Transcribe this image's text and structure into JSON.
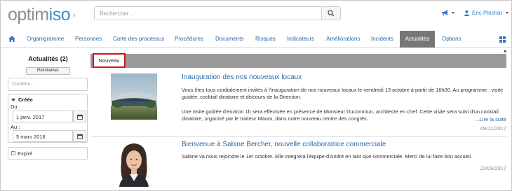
{
  "header": {
    "logo_prefix": "optim",
    "logo_suffix": "iso",
    "search_placeholder": "Rechercher ...",
    "user_name": "Eric Pinchat"
  },
  "nav": {
    "items": [
      "Organigramme",
      "Personnes",
      "Carte des processus",
      "Procédures",
      "Documents",
      "Risques",
      "Indicateurs",
      "Améliorations",
      "Incidents",
      "Actualités",
      "Options"
    ],
    "active": "Actualités"
  },
  "sidebar": {
    "title": "Actualités (2)",
    "reset_label": "Réinitialiser",
    "content_placeholder": "Contenu...",
    "created_label": "Créée",
    "from_label": "Du",
    "from_value": "1 janv. 2017",
    "to_label": "Au :",
    "to_value": "5 mars 2018",
    "expired_label": "Expiré"
  },
  "main": {
    "tab_label": "Nouveau",
    "close_label": "×",
    "news": [
      {
        "title": "Inauguration des nos nouveaux locaux",
        "paragraph1": "Vous êtes tous cordialement invités à l'inauguration de nos nouveaux locaux le vendredi 13 octobre à partir de 16h00. Au programme : visite guidée, cocktail dinatoire et discours de la Direction.",
        "paragraph2": "Une visite guidée d'environ 1h sera effectuée en présence de Monsieur Ducommun, architecte en chef. Cette visite sera suivi d'un cocktail dinatoire, organisé par le traiteur Mauro, dans notre nouveau centre des congrès.",
        "more_label": "...Lire la suite",
        "date": "09/11/2017"
      },
      {
        "title": "Bienvenue à Sabine Bercher, nouvelle collaboratrice commerciale",
        "paragraph1": "Sabine va nous rejoindre le 1er octobre. Elle intégrera l'équipe d'André en tant que commerciale. Merci de lui faire bon accueil.",
        "date": "22/09/2017"
      }
    ]
  },
  "colors": {
    "brand_blue": "#3a8ec8",
    "link_blue": "#2a6aa8",
    "active_tab": "#777777",
    "highlight_red": "#d0141c"
  },
  "icons": [
    "search-icon",
    "megaphone-icon",
    "home-icon",
    "grid-icon",
    "calendar-icon",
    "close-icon"
  ]
}
